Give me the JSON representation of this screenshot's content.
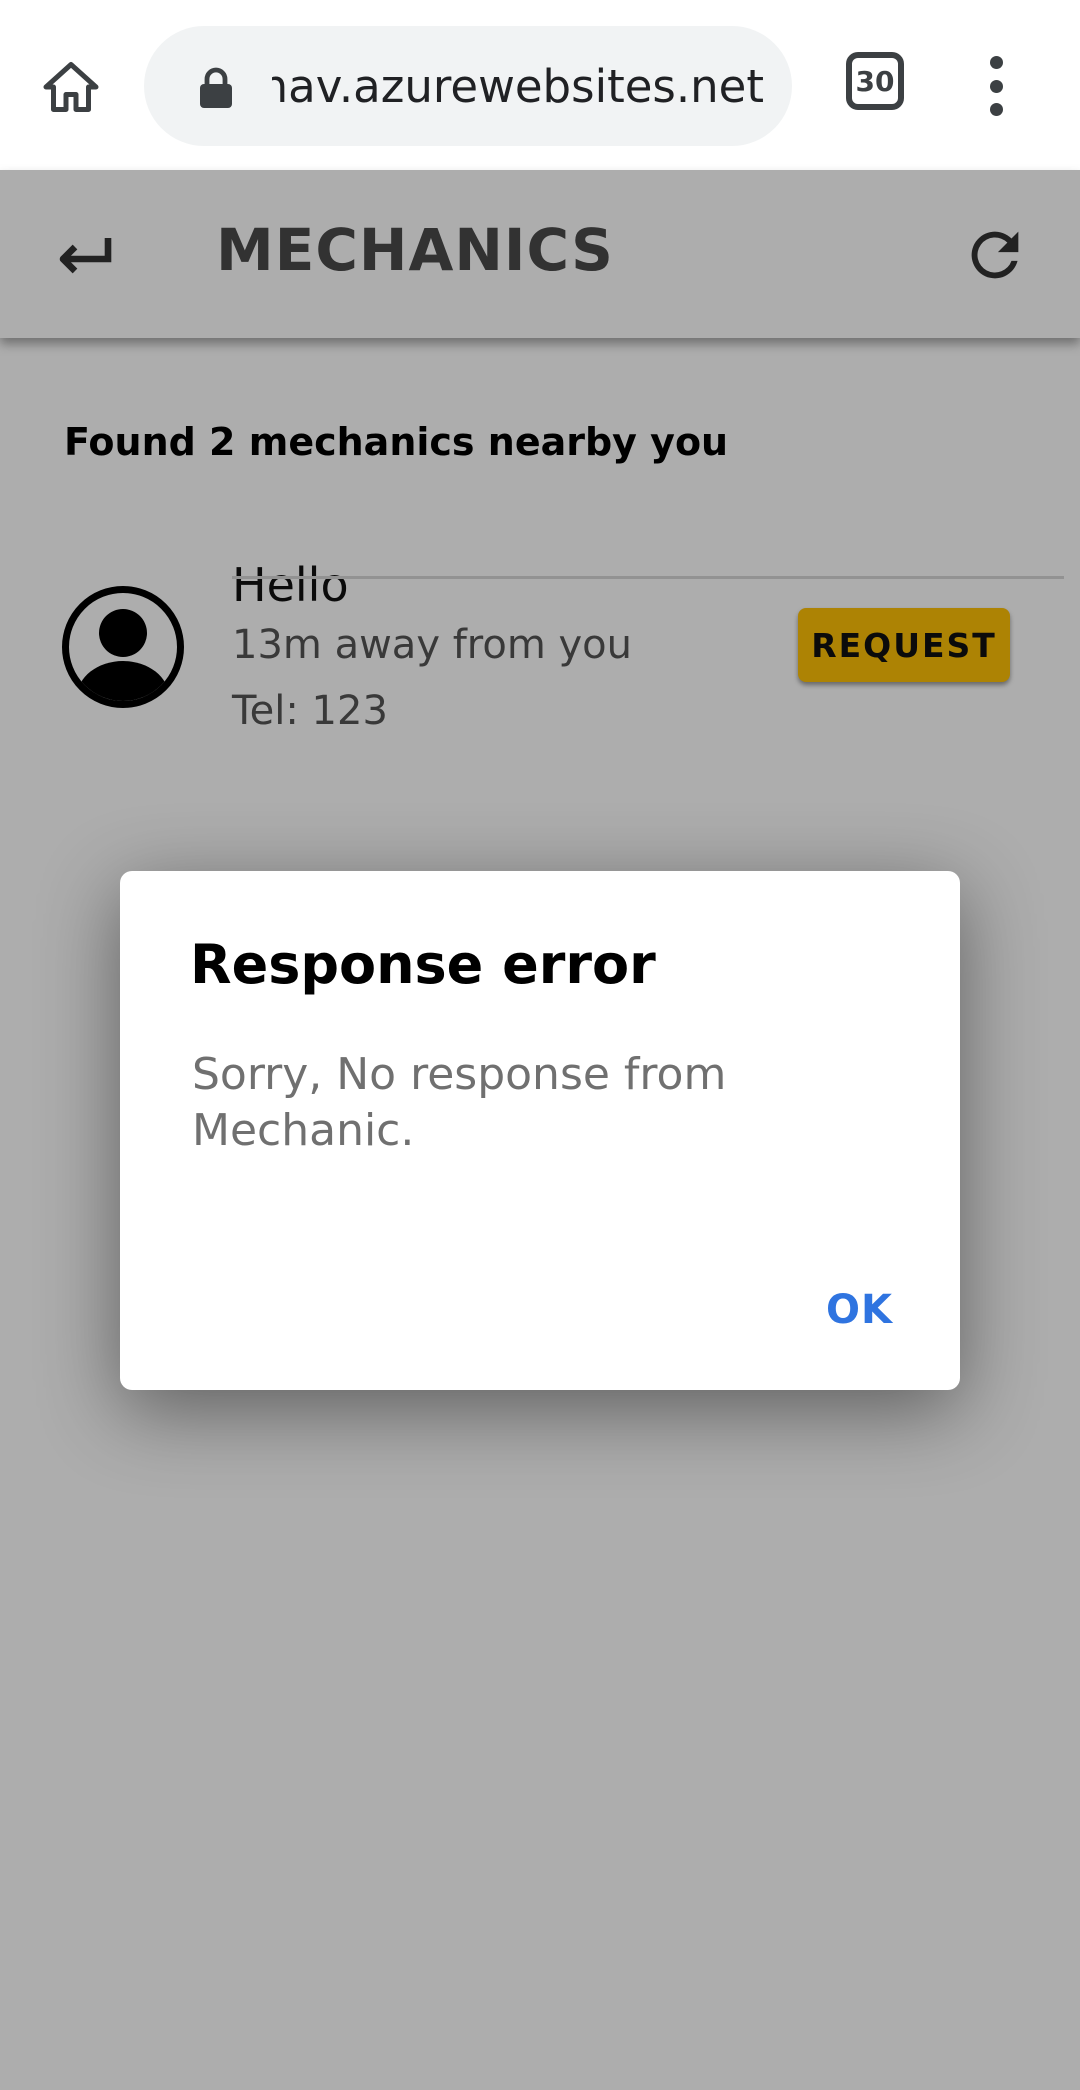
{
  "browser": {
    "url": "mnav.azurewebsites.net",
    "tab_count": "30",
    "home_icon": "home-icon",
    "lock_icon": "lock-icon",
    "menu_icon": "more-vert-icon"
  },
  "app": {
    "header": {
      "title": "MECHANICS",
      "back_icon": "back-arrow-icon",
      "refresh_icon": "refresh-icon"
    },
    "found_text": "Found 2 mechanics nearby you",
    "mechanics": [
      {
        "name": "Hello",
        "distance": "13m away from you",
        "tel": "Tel: 123",
        "request_label": "REQUEST",
        "avatar_icon": "account-circle-icon"
      }
    ],
    "accent_color": "#ffc107"
  },
  "dialog": {
    "title": "Response error",
    "message": "Sorry, No response from Mechanic.",
    "ok_label": "OK",
    "ok_color": "#2f74e0"
  }
}
